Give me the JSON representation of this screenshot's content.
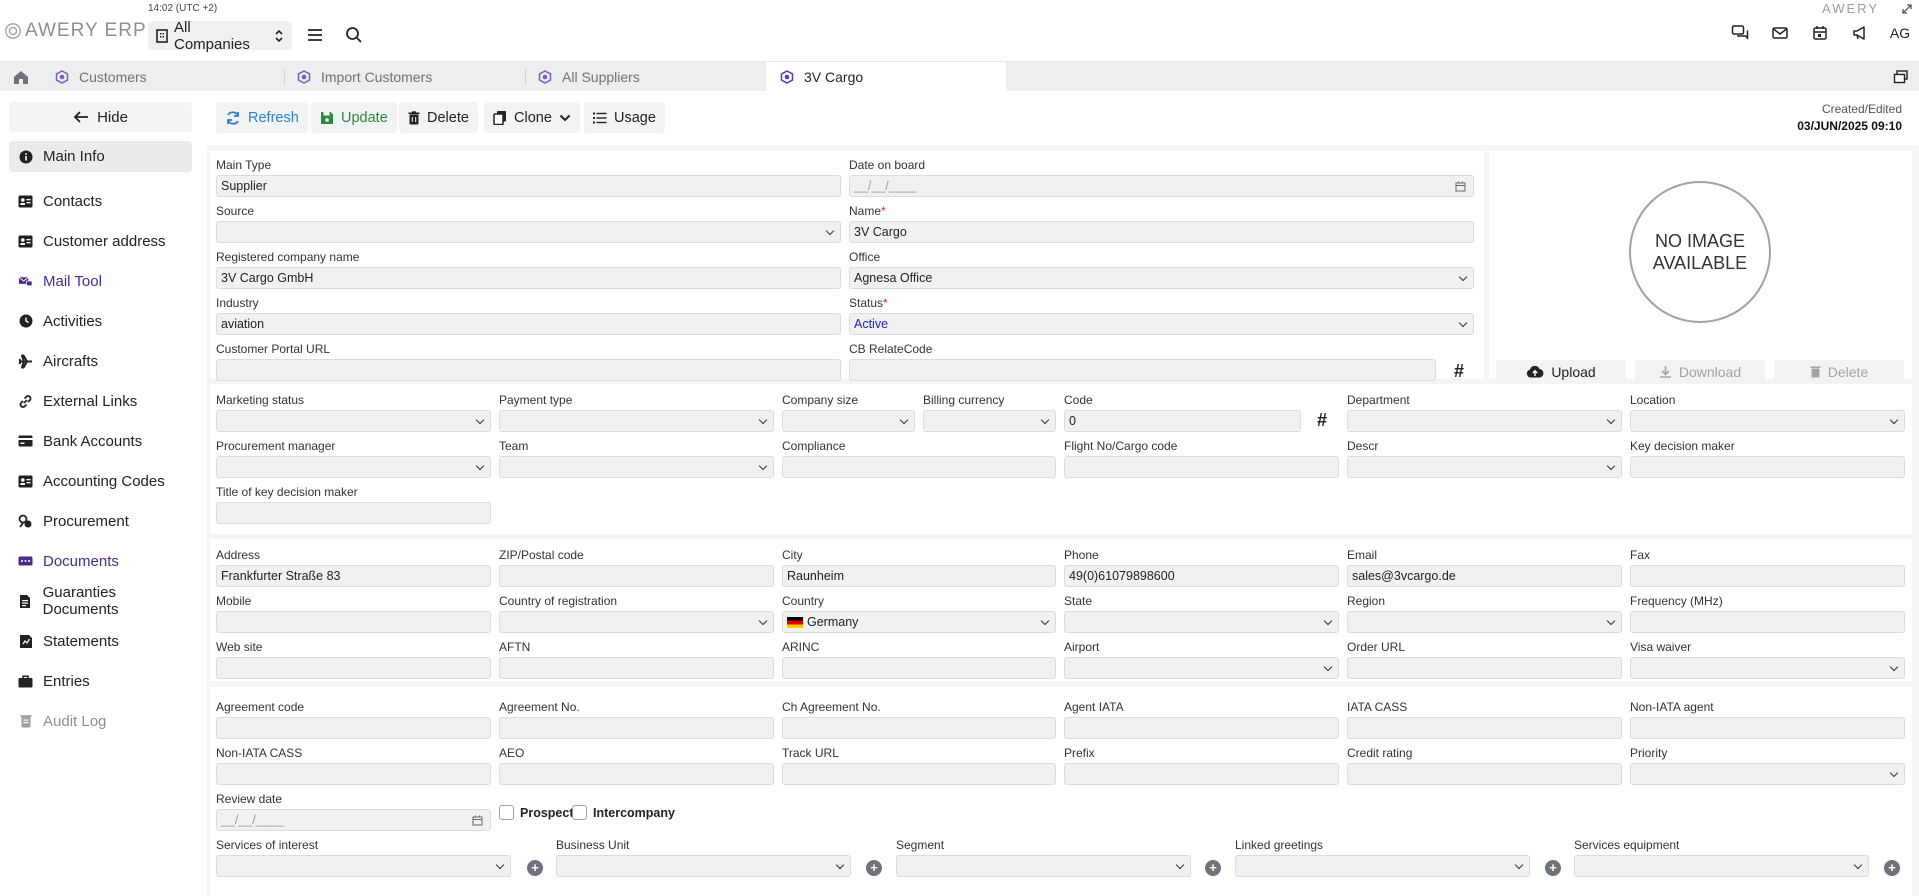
{
  "app": {
    "logo_text": "AWERY ERP",
    "clock": "14:02 (UTC +2)",
    "company_selector": "All Companies",
    "brand_right": "AWERY",
    "avatar": "AG"
  },
  "tabs": [
    {
      "label": "Customers"
    },
    {
      "label": "Import Customers"
    },
    {
      "label": "All Suppliers"
    },
    {
      "label": "3V Cargo"
    }
  ],
  "sidebar": {
    "hide_label": "Hide",
    "items": [
      {
        "label": "Main Info",
        "icon": "info-icon"
      },
      {
        "label": "Contacts",
        "icon": "contacts-icon"
      },
      {
        "label": "Customer address",
        "icon": "address-card-icon"
      },
      {
        "label": "Mail Tool",
        "icon": "mail-tool-icon"
      },
      {
        "label": "Activities",
        "icon": "clock-icon"
      },
      {
        "label": "Aircrafts",
        "icon": "plane-icon"
      },
      {
        "label": "External Links",
        "icon": "link-icon"
      },
      {
        "label": "Bank Accounts",
        "icon": "bank-icon"
      },
      {
        "label": "Accounting Codes",
        "icon": "id-card-icon"
      },
      {
        "label": "Procurement",
        "icon": "procurement-icon"
      },
      {
        "label": "Documents",
        "icon": "documents-icon"
      },
      {
        "label": "Guaranties Documents",
        "icon": "file-icon"
      },
      {
        "label": "Statements",
        "icon": "statements-icon"
      },
      {
        "label": "Entries",
        "icon": "briefcase-icon"
      },
      {
        "label": "Audit Log",
        "icon": "trash-log-icon"
      }
    ]
  },
  "toolbar": {
    "refresh": "Refresh",
    "update": "Update",
    "delete": "Delete",
    "clone": "Clone",
    "usage": "Usage",
    "created_label": "Created/Edited",
    "created_value": "03/JUN/2025 09:10"
  },
  "main_info": {
    "main_type": {
      "label": "Main Type",
      "value": "Supplier"
    },
    "date_on_board": {
      "label": "Date on board",
      "placeholder": "__/__/____"
    },
    "source": {
      "label": "Source",
      "value": ""
    },
    "name": {
      "label": "Name",
      "value": "3V Cargo"
    },
    "registered_name": {
      "label": "Registered company name",
      "value": "3V Cargo GmbH"
    },
    "office": {
      "label": "Office",
      "value": "Agnesa Office"
    },
    "industry": {
      "label": "Industry",
      "value": "aviation"
    },
    "status": {
      "label": "Status",
      "value": "Active"
    },
    "portal_url": {
      "label": "Customer Portal URL",
      "value": ""
    },
    "cb_relate": {
      "label": "CB RelateCode",
      "value": ""
    }
  },
  "image": {
    "no_image": "NO IMAGE AVAILABLE",
    "upload": "Upload",
    "download": "Download",
    "delete": "Delete"
  },
  "section2": {
    "marketing_status": "Marketing status",
    "payment_type": "Payment type",
    "company_size": "Company size",
    "billing_currency": "Billing currency",
    "code": "Code",
    "code_value": "0",
    "department": "Department",
    "location": "Location",
    "procurement_manager": "Procurement manager",
    "team": "Team",
    "compliance": "Compliance",
    "flight_no": "Flight No/Cargo code",
    "descr": "Descr",
    "key_decision_maker": "Key decision maker",
    "title_key_decision_maker": "Title of key decision maker"
  },
  "section3": {
    "address": "Address",
    "address_value": "Frankfurter Straße 83",
    "zip": "ZIP/Postal code",
    "city": "City",
    "city_value": "Raunheim",
    "phone": "Phone",
    "phone_value": "49(0)61079898600",
    "email": "Email",
    "email_value": "sales@3vcargo.de",
    "fax": "Fax",
    "mobile": "Mobile",
    "country_registration": "Country of registration",
    "country": "Country",
    "country_value": "Germany",
    "state": "State",
    "region": "Region",
    "frequency": "Frequency (MHz)",
    "website": "Web site",
    "aftn": "AFTN",
    "arinc": "ARINC",
    "airport": "Airport",
    "order_url": "Order URL",
    "visa_waiver": "Visa waiver"
  },
  "section4": {
    "agreement_code": "Agreement code",
    "agreement_no": "Agreement No.",
    "ch_agreement_no": "Ch Agreement No.",
    "agent_iata": "Agent IATA",
    "iata_cass": "IATA CASS",
    "non_iata_agent": "Non-IATA agent",
    "non_iata_cass": "Non-IATA CASS",
    "aeo": "AEO",
    "track_url": "Track URL",
    "prefix": "Prefix",
    "credit_rating": "Credit rating",
    "priority": "Priority",
    "review_date": "Review date",
    "review_placeholder": "__/__/____",
    "prospect": "Prospect",
    "intercompany": "Intercompany",
    "services_interest": "Services of interest",
    "business_unit": "Business Unit",
    "segment": "Segment",
    "linked_greetings": "Linked greetings",
    "services_equipment": "Services equipment"
  }
}
